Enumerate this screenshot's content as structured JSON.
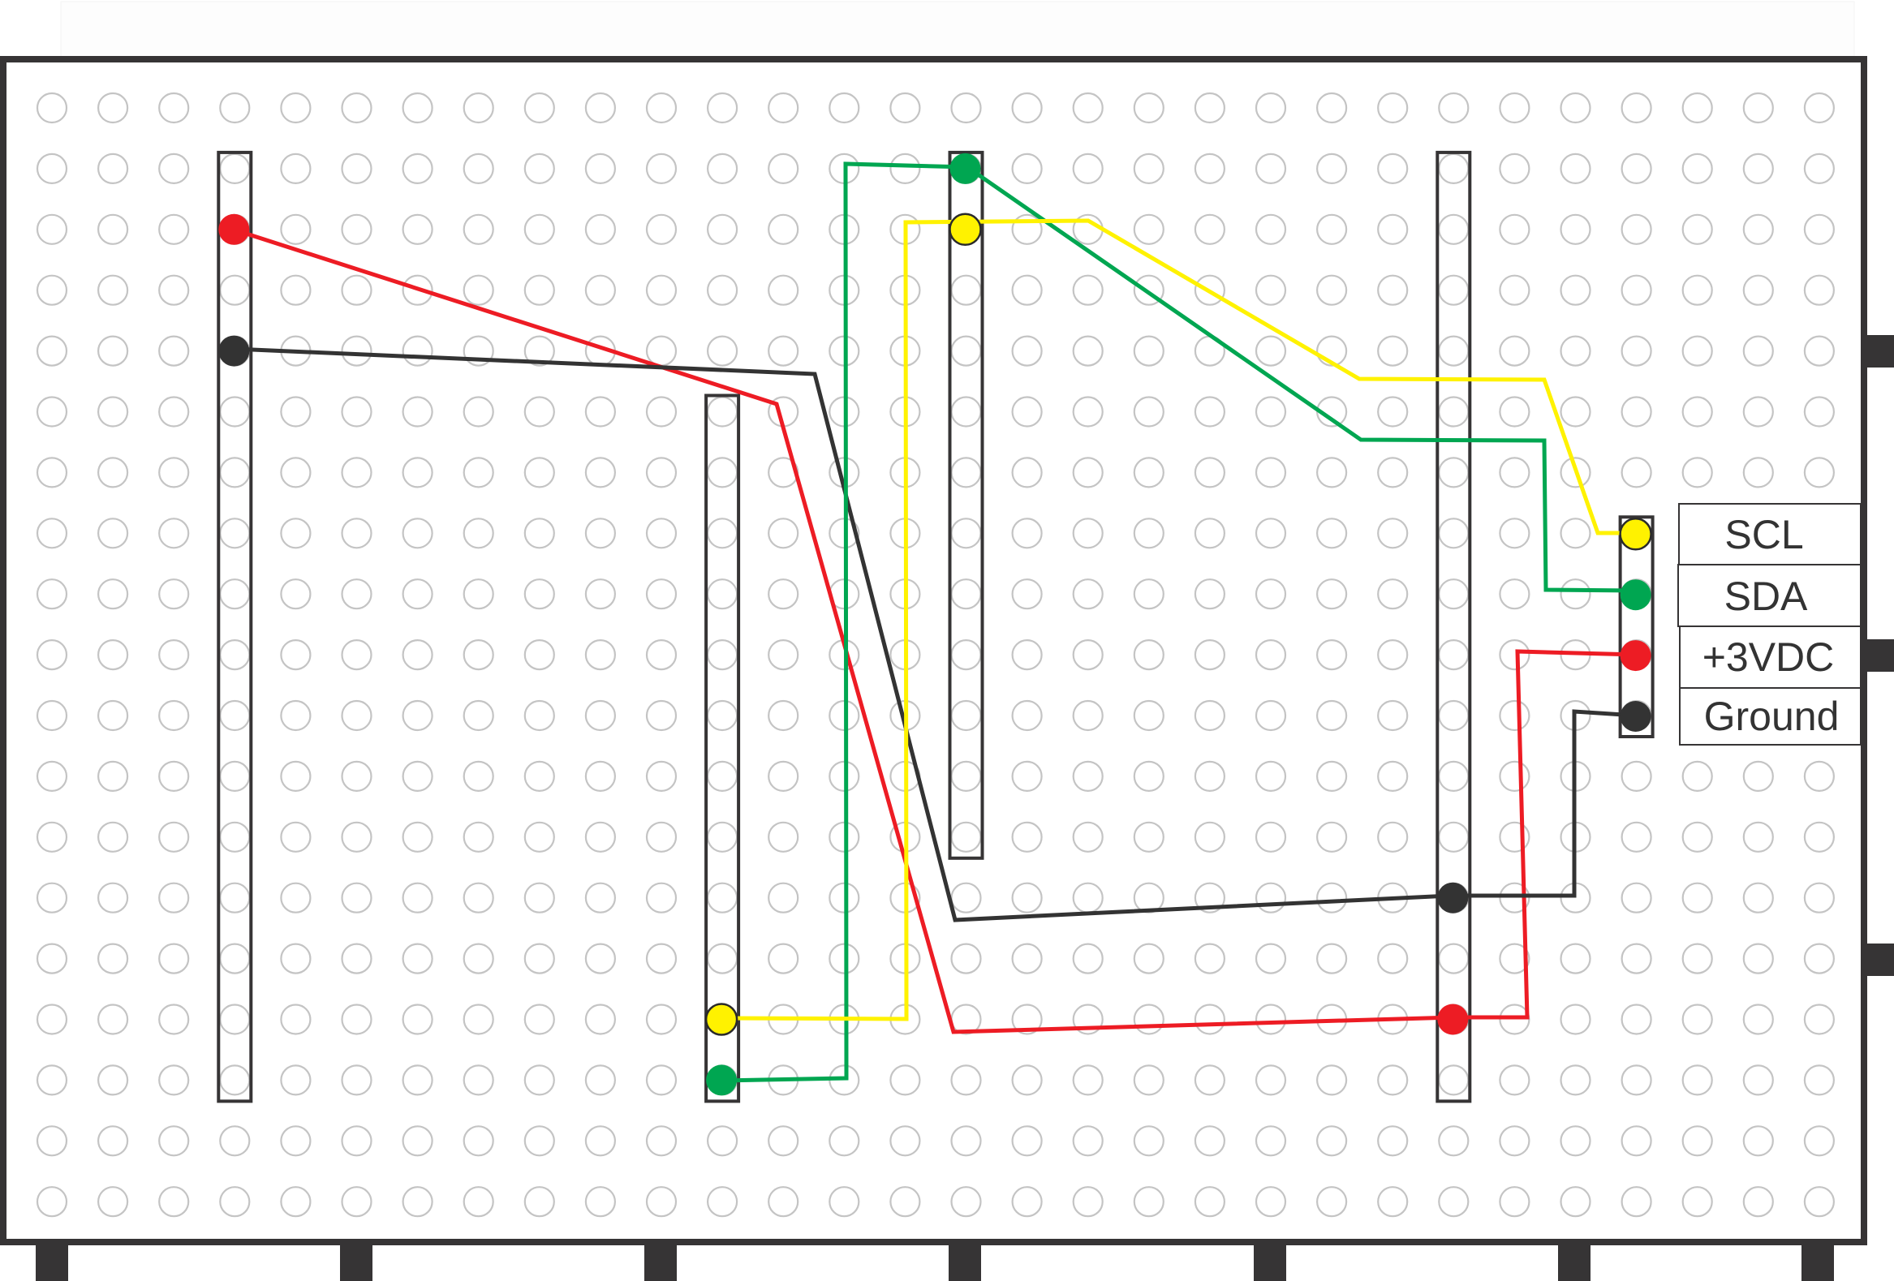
{
  "diagram": {
    "title": "",
    "board": {
      "name": "perfboard",
      "hole_columns": 30,
      "hole_rows": 19,
      "colors": {
        "frame": "#363435",
        "hole": "#c4c4c4",
        "strip": "#363435",
        "background": "#ffffff"
      }
    },
    "wire_colors": {
      "red": "#ed1c24",
      "black": "#333333",
      "green": "#00a651",
      "yellow": "#fff200"
    },
    "strips": [
      {
        "id": "strip-1",
        "column": 3,
        "row_start": 1,
        "row_end": 16
      },
      {
        "id": "strip-2",
        "column": 11,
        "row_start": 5,
        "row_end": 16
      },
      {
        "id": "strip-3",
        "column": 15,
        "row_start": 1,
        "row_end": 12
      },
      {
        "id": "strip-4",
        "column": 23,
        "row_start": 1,
        "row_end": 16
      },
      {
        "id": "strip-5",
        "column": 26,
        "row_start": 7,
        "row_end": 10
      }
    ],
    "connector_labels": [
      {
        "text": "SCL",
        "wire": "yellow"
      },
      {
        "text": "SDA",
        "wire": "green"
      },
      {
        "text": "+3VDC",
        "wire": "red"
      },
      {
        "text": "Ground",
        "wire": "black"
      }
    ],
    "wires": [
      {
        "name": "power-wire",
        "color": "red",
        "from": "strip-1 row 2",
        "via": [
          "strip-4 row 15"
        ],
        "to": "+3VDC"
      },
      {
        "name": "ground-wire",
        "color": "black",
        "from": "strip-1 row 4",
        "via": [
          "strip-4 row 13"
        ],
        "to": "Ground"
      },
      {
        "name": "sda-wire",
        "color": "green",
        "from": "strip-2 row 16",
        "via": [
          "strip-3 row 1"
        ],
        "to": "SDA"
      },
      {
        "name": "scl-wire",
        "color": "yellow",
        "from": "strip-2 row 15",
        "via": [
          "strip-3 row 2"
        ],
        "to": "SCL"
      }
    ]
  }
}
